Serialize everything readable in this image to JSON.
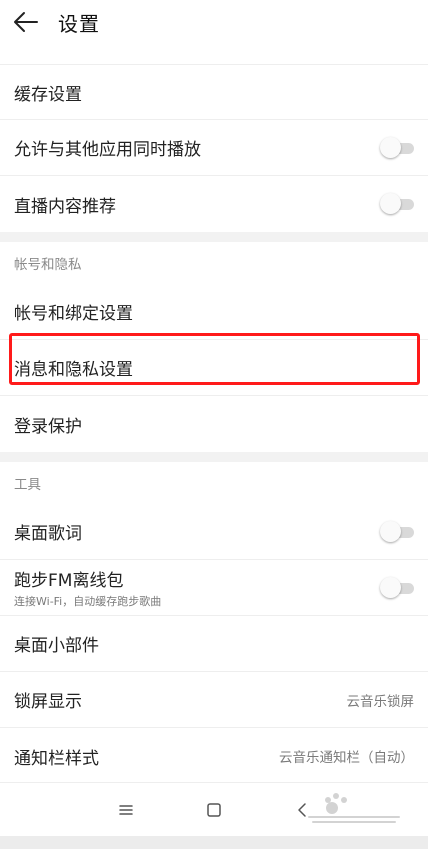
{
  "header": {
    "title": "设置"
  },
  "sections": {
    "general": {
      "rows": [
        {
          "label": "缓存设置"
        },
        {
          "label": "允许与其他应用同时播放",
          "toggle": false
        },
        {
          "label": "直播内容推荐",
          "toggle": false
        }
      ]
    },
    "account": {
      "header": "帐号和隐私",
      "rows": [
        {
          "label": "帐号和绑定设置"
        },
        {
          "label": "消息和隐私设置"
        },
        {
          "label": "登录保护"
        }
      ]
    },
    "tools": {
      "header": "工具",
      "rows": [
        {
          "label": "桌面歌词",
          "toggle": false
        },
        {
          "label": "跑步FM离线包",
          "sub": "连接Wi-Fi，自动缓存跑步歌曲",
          "toggle": false
        },
        {
          "label": "桌面小部件"
        },
        {
          "label": "锁屏显示",
          "value": "云音乐锁屏"
        },
        {
          "label": "通知栏样式",
          "value": "云音乐通知栏（自动）"
        }
      ]
    }
  },
  "navbar": {
    "icons": [
      "menu-icon",
      "home-square-icon",
      "back-triangle-icon"
    ]
  },
  "colors": {
    "highlight": "#ff1a1a",
    "gap": "#f2f2f2",
    "toggle_track": "#d9d9d9"
  }
}
